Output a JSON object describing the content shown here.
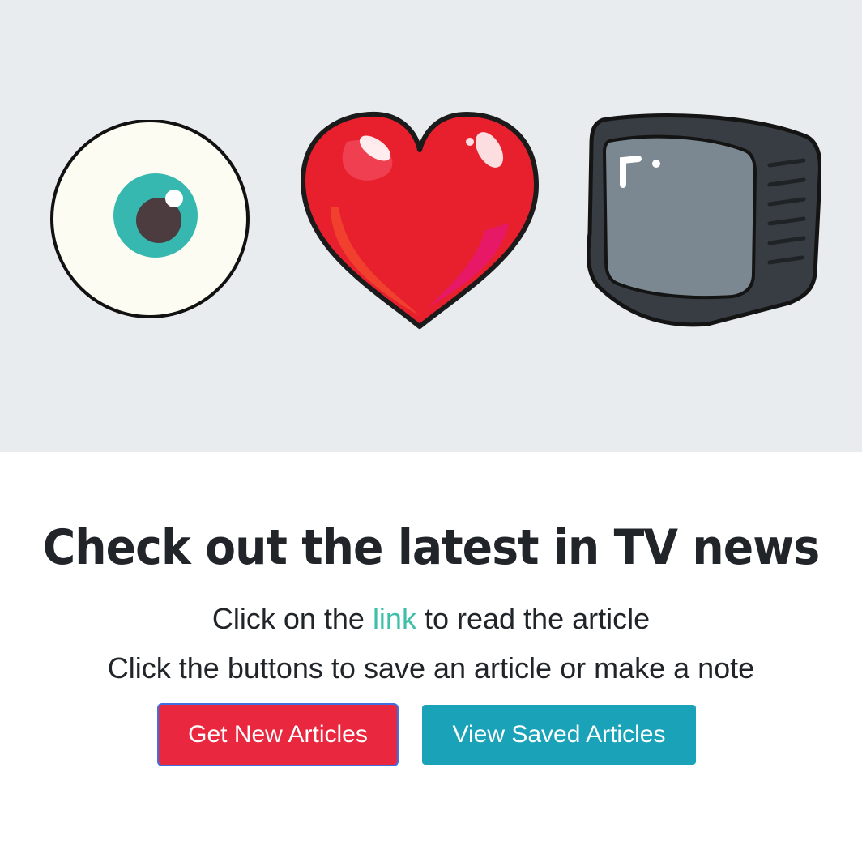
{
  "hero": {
    "icons": [
      "eye-icon",
      "heart-icon",
      "tv-icon"
    ]
  },
  "content": {
    "headline": "Check out the latest in TV news",
    "line1_before": "Click on the ",
    "line1_link": "link",
    "line1_after": " to read the article",
    "line2": "Click the buttons to save an article or make a note"
  },
  "buttons": {
    "get_new": "Get New Articles",
    "view_saved": "View Saved Articles"
  },
  "colors": {
    "hero_bg": "#e9ecef",
    "link": "#3fbfa8",
    "get_button": "#e9283f",
    "view_button": "#1aa2b8",
    "heart": "#e8202e",
    "eye_iris": "#3ab7b0"
  }
}
